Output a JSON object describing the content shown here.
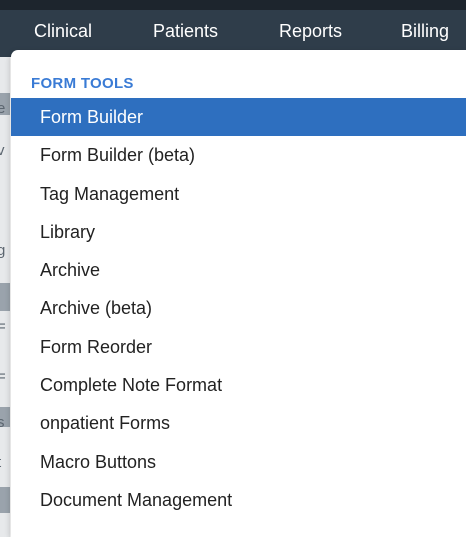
{
  "nav": {
    "items": [
      {
        "label": "Clinical"
      },
      {
        "label": "Patients"
      },
      {
        "label": "Reports"
      },
      {
        "label": "Billing"
      }
    ]
  },
  "left_strip": {
    "chars": [
      "e",
      "v",
      "g",
      "=",
      "=",
      "s",
      "t"
    ]
  },
  "dropdown": {
    "header": "FORM TOOLS",
    "items": [
      {
        "label": "Form Builder",
        "highlighted": true
      },
      {
        "label": "Form Builder (beta)"
      },
      {
        "label": "Tag Management"
      },
      {
        "label": "Library"
      },
      {
        "label": "Archive"
      },
      {
        "label": "Archive (beta)"
      },
      {
        "label": "Form Reorder"
      },
      {
        "label": "Complete Note Format"
      },
      {
        "label": "onpatient Forms"
      },
      {
        "label": "Macro Buttons"
      },
      {
        "label": "Document Management"
      }
    ]
  },
  "colors": {
    "nav_bg": "#2f3d4a",
    "header_text": "#3a7bd5",
    "highlight_bg": "#2e6fbf"
  }
}
